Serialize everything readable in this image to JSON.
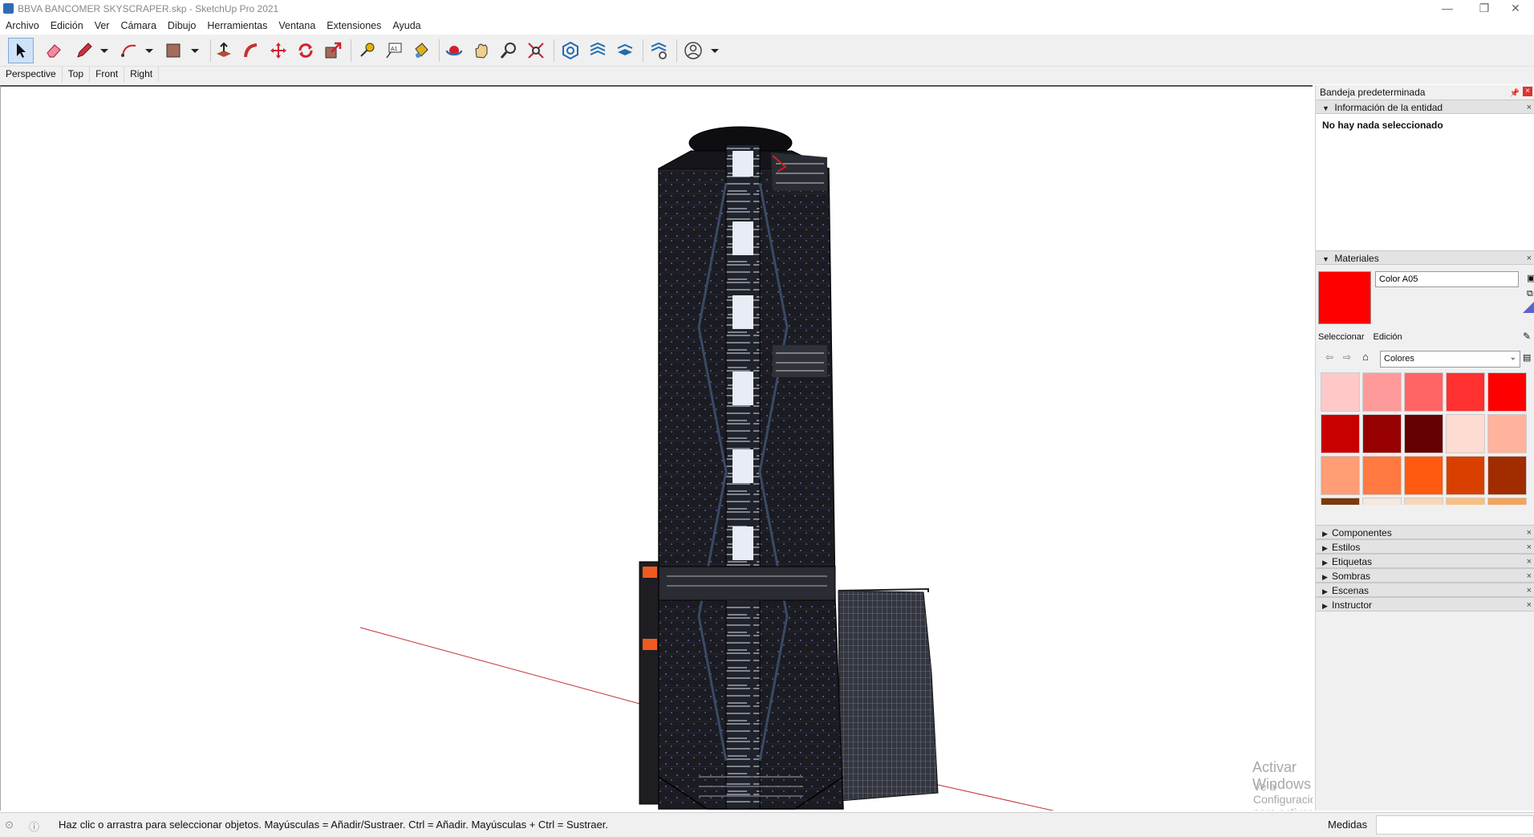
{
  "window": {
    "title": "BBVA BANCOMER SKYSCRAPER.skp - SketchUp Pro 2021"
  },
  "menu": [
    "Archivo",
    "Edición",
    "Ver",
    "Cámara",
    "Dibujo",
    "Herramientas",
    "Ventana",
    "Extensiones",
    "Ayuda"
  ],
  "toolbar": {
    "tools": [
      "select-icon",
      "eraser-icon",
      "pencil-icon",
      "arc-icon",
      "rectangle-icon",
      "push-pull-icon",
      "follow-me-icon",
      "move-icon",
      "rotate-icon",
      "scale-icon",
      "tape-measure-icon",
      "text-icon",
      "paint-bucket-icon",
      "orbit-icon",
      "pan-icon",
      "zoom-icon",
      "zoom-extents-icon",
      "warehouse-icon",
      "extension-warehouse-icon",
      "layout-icon",
      "extension-manager-icon",
      "account-icon"
    ]
  },
  "scenes": [
    "Perspective",
    "Top",
    "Front",
    "Right"
  ],
  "tray": {
    "title": "Bandeja predeterminada",
    "entity_info": {
      "header": "Información de la entidad",
      "status": "No hay nada seleccionado"
    },
    "materials": {
      "header": "Materiales",
      "current_name": "Color A05",
      "current_color": "#ff0000",
      "tab_select": "Seleccionar",
      "tab_edit": "Edición",
      "library": "Colores",
      "swatches": [
        "#ffc9c9",
        "#ff9a9a",
        "#ff6565",
        "#ff3030",
        "#ff0000",
        "#c80000",
        "#960000",
        "#640000",
        "#ffdcd1",
        "#ffb39d",
        "#ff9d75",
        "#ff7940",
        "#ff5a10",
        "#d94000",
        "#a02c00",
        "#7a3a10",
        "#f5e8df",
        "#f7d6b9",
        "#f8bf83",
        "#f3a35d"
      ]
    },
    "collapsed_panels": [
      "Componentes",
      "Estilos",
      "Etiquetas",
      "Sombras",
      "Escenas",
      "Instructor"
    ]
  },
  "watermark": {
    "line1": "Activar Windows",
    "line2": "Ve a Configuración para activar Windows."
  },
  "status": {
    "message": "Haz clic o arrastra para seleccionar objetos. Mayúsculas = Añadir/Sustraer. Ctrl = Añadir. Mayúsculas + Ctrl = Sustraer.",
    "measure_label": "Medidas",
    "measure_value": ""
  }
}
